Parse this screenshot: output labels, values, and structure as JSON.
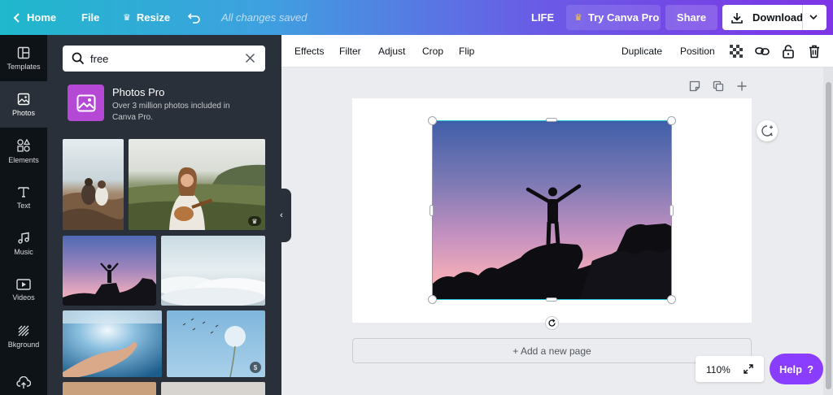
{
  "topbar": {
    "home_label": "Home",
    "file_label": "File",
    "resize_label": "Resize",
    "saved_status": "All changes saved",
    "doc_title": "LIFE",
    "try_pro_label": "Try Canva Pro",
    "share_label": "Share",
    "download_label": "Download",
    "gradient_start": "#1fb8cc",
    "gradient_end": "#7d35e6"
  },
  "rail": {
    "items": [
      {
        "label": "Templates",
        "icon": "templates-icon"
      },
      {
        "label": "Photos",
        "icon": "photos-icon"
      },
      {
        "label": "Elements",
        "icon": "elements-icon"
      },
      {
        "label": "Text",
        "icon": "text-icon"
      },
      {
        "label": "Music",
        "icon": "music-icon"
      },
      {
        "label": "Videos",
        "icon": "videos-icon"
      },
      {
        "label": "Bkground",
        "icon": "background-icon"
      },
      {
        "label": "",
        "icon": "upload-icon"
      }
    ],
    "active": "Photos"
  },
  "panel": {
    "search_value": "free",
    "pro_title": "Photos Pro",
    "pro_desc": "Over 3 million photos included in Canva Pro.",
    "pro_color": "#b549d6",
    "thumbnails": [
      {
        "subject": "couple sitting on beach rocks"
      },
      {
        "subject": "woman playing ukulele in field",
        "badge": "crown-icon"
      },
      {
        "subject": "silhouette with raised arms at sunset"
      },
      {
        "subject": "sea of clouds"
      },
      {
        "subject": "hand reaching over sparkling sea"
      },
      {
        "subject": "dandelion seeds blowing",
        "badge": "$"
      }
    ]
  },
  "toolbar": {
    "effects": "Effects",
    "filter": "Filter",
    "adjust": "Adjust",
    "crop": "Crop",
    "flip": "Flip",
    "duplicate": "Duplicate",
    "position": "Position"
  },
  "canvas": {
    "add_page_label": "+ Add a new page",
    "selection_color": "#1ec6d8",
    "photo_subject": "silhouette of person with raised arms on rock at sunset"
  },
  "zoom": {
    "level": "110%"
  },
  "help": {
    "label": "Help",
    "icon_label": "?",
    "color": "#8b3dff"
  }
}
